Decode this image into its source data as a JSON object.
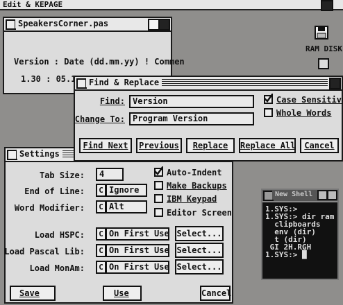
{
  "desktop": {
    "menubar_title": "Edit & KEPAGE",
    "drive_label": "RAM DISK"
  },
  "editor_window": {
    "title": "SpeakersCorner.pas",
    "line1": "Version : Date (dd.mm.yy) ! Commen",
    "line2": "1.30 : 05.1"
  },
  "find_replace": {
    "title": "Find & Replace",
    "find_label": "Find:",
    "find_value": "Version",
    "change_label": "Change To:",
    "change_value": "Program Version",
    "case_sensitive_label": "Case Sensitive",
    "whole_words_label": "Whole Words",
    "case_sensitive_checked": true,
    "whole_words_checked": false,
    "buttons": [
      "Find Next",
      "Previous",
      "Replace",
      "Replace All",
      "Cancel"
    ]
  },
  "settings": {
    "title": "Settings",
    "tab_size_label": "Tab Size:",
    "tab_size_value": "4",
    "end_of_line_label": "End of Line:",
    "end_of_line_value": "Ignore",
    "word_modifier_label": "Word Modifier:",
    "word_modifier_value": "Alt",
    "checkboxes": [
      {
        "label": "Auto-Indent",
        "checked": true
      },
      {
        "label": "Make Backups",
        "checked": false
      },
      {
        "label": "IBM Keypad",
        "checked": false
      },
      {
        "label": "Editor Screen",
        "checked": false
      }
    ],
    "load_rows": [
      {
        "label": "Load HSPC:",
        "value": "On First Use",
        "button": "Select..."
      },
      {
        "label": "Load Pascal Lib:",
        "value": "On First Use",
        "button": "Select..."
      },
      {
        "label": "Load MonAm:",
        "value": "On First Use",
        "button": "Select..."
      }
    ],
    "popup_symbol": "C",
    "save_label": "Save",
    "use_label": "Use",
    "cancel_label": "Cancel"
  },
  "shell": {
    "title": "New Shell",
    "lines": [
      "1.SYS:>",
      "1.SYS:> dir ram",
      "  clipboards",
      "  env (dir)",
      "  t (dir)",
      " GI 2H.RGH",
      "1.SYS:> █"
    ]
  }
}
